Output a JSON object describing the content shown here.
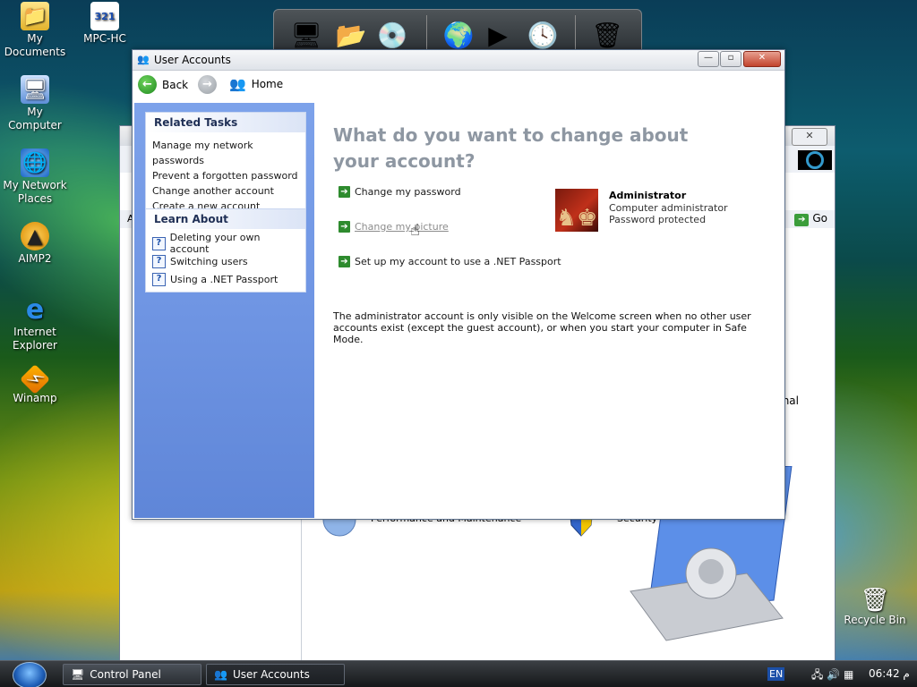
{
  "desktop": {
    "icons": [
      {
        "label": "My Documents",
        "icon": "folder-documents-icon"
      },
      {
        "label": "MPC-HC",
        "icon": "media-player-icon"
      },
      {
        "label": "My Computer",
        "icon": "computer-icon"
      },
      {
        "label": "My Network Places",
        "icon": "network-icon"
      },
      {
        "label": "AIMP2",
        "icon": "aimp-icon"
      },
      {
        "label": "Internet Explorer",
        "icon": "ie-icon"
      },
      {
        "label": "Winamp",
        "icon": "winamp-icon"
      },
      {
        "label": "Recycle Bin",
        "icon": "recycle-bin-icon"
      }
    ],
    "mpc_badge": "321"
  },
  "background_window": {
    "go_label": "Go",
    "partial_text_right": "nal",
    "partial_text_left": "A",
    "bottom_text_1": "Performance and Maintenance",
    "bottom_text_2": "Security Center"
  },
  "window": {
    "title": "User Accounts",
    "toolbar": {
      "back_label": "Back",
      "home_label": "Home"
    },
    "related_tasks": {
      "title": "Related Tasks",
      "items": [
        "Manage my network passwords",
        "Prevent a forgotten password",
        "Change another account",
        "Create a new account"
      ]
    },
    "learn_about": {
      "title": "Learn About",
      "items": [
        "Deleting your own account",
        "Switching users",
        "Using a .NET Passport"
      ]
    },
    "headline": "What do you want to change about your account?",
    "options": [
      "Change my password",
      "Change my picture",
      "Set up my account to use a .NET Passport"
    ],
    "account": {
      "name": "Administrator",
      "type": "Computer administrator",
      "status": "Password protected"
    },
    "note": "The administrator account is only visible on the Welcome screen when no other user accounts exist (except the guest account), or when you start your computer in Safe Mode."
  },
  "taskbar": {
    "items": [
      "Control Panel",
      "User Accounts"
    ],
    "language": "EN",
    "clock": "06:42 م"
  },
  "colors": {
    "sidebar": "#6f95e3",
    "headline": "#8e97a2",
    "link_arrow": "#2e8b2e"
  }
}
